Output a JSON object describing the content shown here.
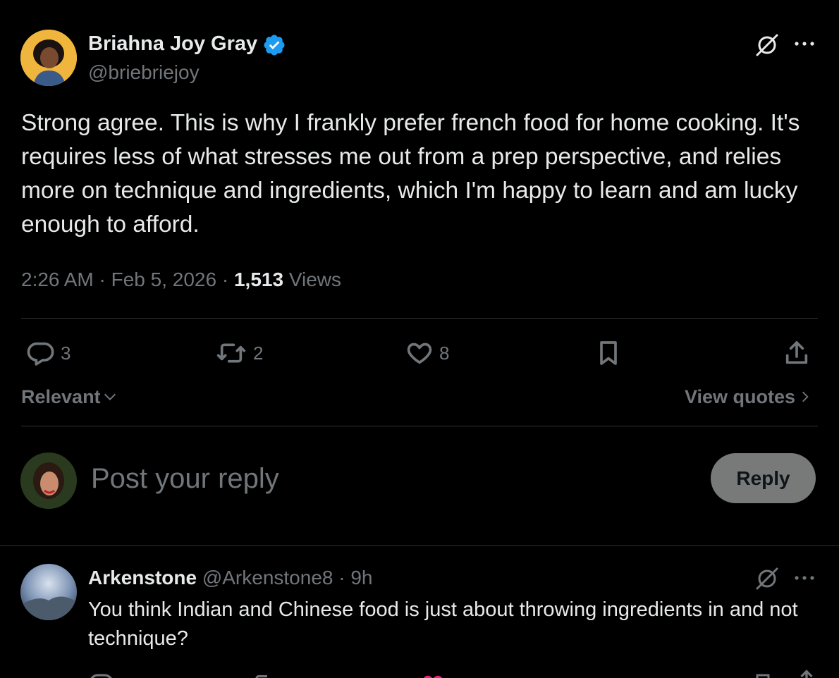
{
  "tweet": {
    "author_name": "Briahna Joy Gray",
    "author_handle": "@briebriejoy",
    "verified": true,
    "text": "Strong agree. This is why I frankly prefer french food for home cooking. It's requires less of what stresses me out from a prep perspective, and relies more on technique and ingredients, which I'm happy to learn and am lucky enough to afford.",
    "time": "2:26 AM",
    "date": "Feb 5, 2026",
    "views_count": "1,513",
    "views_label": "Views",
    "separator": "·"
  },
  "actions": {
    "replies": "3",
    "reposts": "2",
    "likes": "8"
  },
  "sort": {
    "label": "Relevant",
    "view_quotes": "View quotes"
  },
  "composer": {
    "placeholder": "Post your reply",
    "reply_button": "Reply"
  },
  "reply": {
    "author_name": "Arkenstone",
    "author_handle": "@Arkenstone8",
    "age": "9h",
    "text": "You think Indian and Chinese food is just about throwing ingredients in and not technique?"
  },
  "colors": {
    "background": "#000000",
    "text": "#e7e9ea",
    "muted": "#71767b",
    "verified": "#1d9bf0",
    "divider": "#2f3336",
    "reply_button_bg": "#787a7a",
    "like_pink": "#f91880"
  },
  "icons": [
    "verified-badge-icon",
    "grok-icon",
    "more-icon",
    "reply-icon",
    "repost-icon",
    "like-icon",
    "bookmark-icon",
    "share-icon",
    "chevron-down-icon",
    "chevron-right-icon"
  ]
}
